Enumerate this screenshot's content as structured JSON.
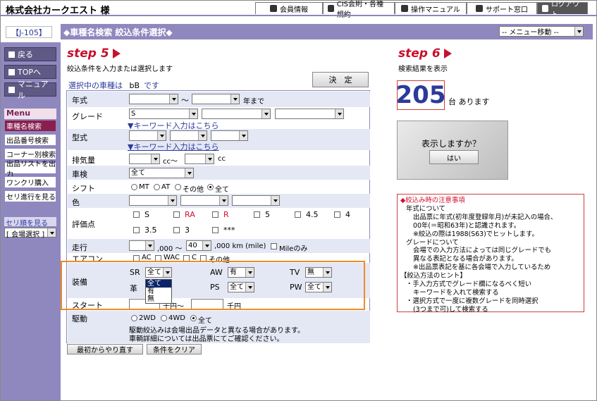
{
  "header": {
    "company": "株式会社カークエスト 様",
    "nav": [
      {
        "label": "会員情報",
        "icon": "club-icon"
      },
      {
        "label": "CIS会則・各種規約",
        "icon": "document-icon"
      },
      {
        "label": "操作マニュアル",
        "icon": "question-icon"
      },
      {
        "label": "サポート窓口",
        "icon": "phone-icon"
      },
      {
        "label": "ログアウト",
        "icon": "logout-icon"
      }
    ]
  },
  "page": {
    "id": "【J-105】",
    "title": "◆車種名検索 絞込条件選択◆",
    "menu_select": "-- メニュー移動 --"
  },
  "sidebar": {
    "back": "戻る",
    "top": "TOPへ",
    "manual": "マニュアル",
    "menu_heading": "Menu",
    "items": [
      "車種名検索",
      "出品番号検索",
      "コーナー別検索",
      "出品リストを出力",
      "ワンクリ購入",
      "セリ進行を見る"
    ],
    "seri_heading": "セリ順を見る",
    "seri_select": "[ 会場選択 ]"
  },
  "step5": {
    "title": "step 5",
    "subtitle": "絞込条件を入力または選択します",
    "decide": "決　定",
    "selected_prefix": "選択中の車種は",
    "selected_model": "bB",
    "selected_suffix": "です"
  },
  "form": {
    "year_label": "年式",
    "year_tilde": "～",
    "year_suffix": "年まで",
    "grade_label": "グレード",
    "grade_value": "S",
    "keyword_link": "▼キーワード入力はこちら",
    "model_label": "型式",
    "displacement_label": "排気量",
    "cc1": "cc～",
    "cc2": "cc",
    "shaken_label": "車検",
    "shaken_value": "全て",
    "shift_label": "シフト",
    "shift_options": [
      "MT",
      "AT",
      "その他",
      "全て"
    ],
    "color_label": "色",
    "eval_label": "評価点",
    "eval_options": [
      "S",
      "RA",
      "R",
      "5",
      "4.5",
      "4",
      "3.5",
      "3",
      "***"
    ],
    "mileage_label": "走行",
    "mileage_a": ",000 ～",
    "mileage_value": "40",
    "mileage_b": ",000 km (mile)",
    "mileage_only": "Mileのみ",
    "aircon_label": "エアコン",
    "aircon_options": [
      "AC",
      "WAC",
      "C",
      "その他"
    ],
    "equip_label": "装備",
    "sr_label": "SR",
    "sr_value": "全て",
    "sr_options": [
      "全て",
      "有",
      "無"
    ],
    "leather_label": "革",
    "aw_label": "AW",
    "aw_value": "有",
    "ps_label": "PS",
    "ps_value": "全て",
    "tv_label": "TV",
    "tv_value": "無",
    "pw_label": "PW",
    "pw_value": "全て",
    "start_label": "スタート",
    "start_mid": "千円～",
    "start_suffix": "千円",
    "drive_label": "駆動",
    "drive_options": [
      "2WD",
      "4WD",
      "全て"
    ],
    "drive_note1": "駆動絞込みは会場出品データと異なる場合があります。",
    "drive_note2": "車輌詳細については出品票にてご確認ください。",
    "restart": "最初からやり直す",
    "clear": "条件をクリア"
  },
  "step6": {
    "title": "step 6",
    "subtitle": "検索結果を表示",
    "count": "205",
    "count_suffix": "台 あります",
    "show_question": "表示しますか？",
    "yes": "はい"
  },
  "notes": [
    "◆絞込み時の注意事項",
    "年式について",
    "出品票に年式(初年度登録年月)が未記入の場合、",
    "00年(＝昭和63年)と認識されます。",
    "※絞込の際は1988(S63)でヒットします。",
    "グレードについて",
    "会場での入力方法によっては同じグレードでも",
    "異なる表記となる場合があります。",
    "※出品票表記を基に各会場で入力しているため",
    "【絞込方法のヒント】",
    "・手入力方式でグレード欄になるべく短い",
    "キーワードを入れて検索する",
    "・選択方式で一度に複数グレードを同時選択",
    "(3つまで可)して検索する"
  ]
}
